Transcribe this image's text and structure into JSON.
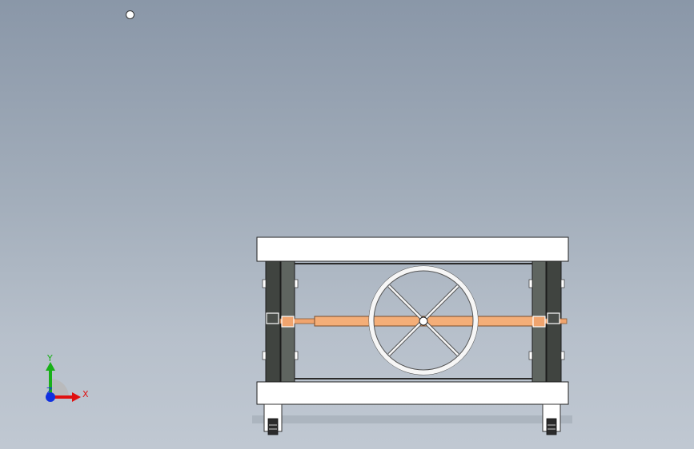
{
  "viewport": {
    "background_top": "#8a97a8",
    "background_bottom": "#c0c8d2"
  },
  "model": {
    "description_icon": "roller-table-assembly-icon",
    "colors": {
      "slab": "#ffffff",
      "frame_dark": "#3a3d3a",
      "frame_mid": "#5d625e",
      "shaft": "#f0a46e",
      "shaft_edge": "#8b5a33",
      "wheel": "#f4f4f4",
      "wheel_edge": "#555555"
    }
  },
  "triad": {
    "x_label": "X",
    "y_label": "Y",
    "z_label": "Z",
    "x_color": "#e01010",
    "y_color": "#18b018",
    "z_color": "#1030e0"
  }
}
